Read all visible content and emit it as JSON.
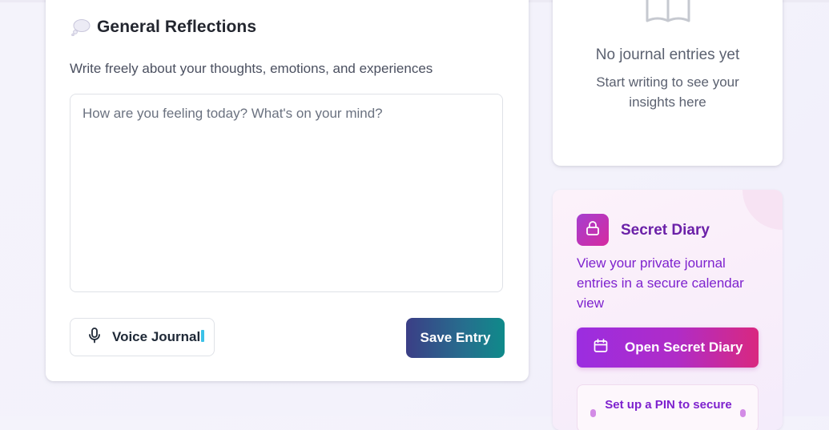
{
  "journal": {
    "title": "General Reflections",
    "title_icon": "thought-bubble-icon",
    "subtitle": "Write freely about your thoughts, emotions, and experiences",
    "entry_value": "",
    "entry_placeholder": "How are you feeling today? What's on your mind?",
    "voice_label": "Voice Journal",
    "voice_icon": "microphone-icon",
    "save_label": "Save Entry"
  },
  "insights": {
    "icon": "book-icon",
    "empty_title": "No journal entries yet",
    "empty_subtitle": "Start writing to see your insights here"
  },
  "secret_diary": {
    "icon": "lock-icon",
    "title": "Secret Diary",
    "description": "View your private journal entries in a secure calendar view",
    "open_label": "Open Secret Diary",
    "open_icon": "calendar-icon",
    "pin_note": "Set up a PIN to secure"
  },
  "colors": {
    "save_gradient": [
      "#3b3e86",
      "#0f8a8a"
    ],
    "diary_gradient": [
      "#9b2de0",
      "#d9287f"
    ],
    "diary_text": "#7e22ce"
  }
}
